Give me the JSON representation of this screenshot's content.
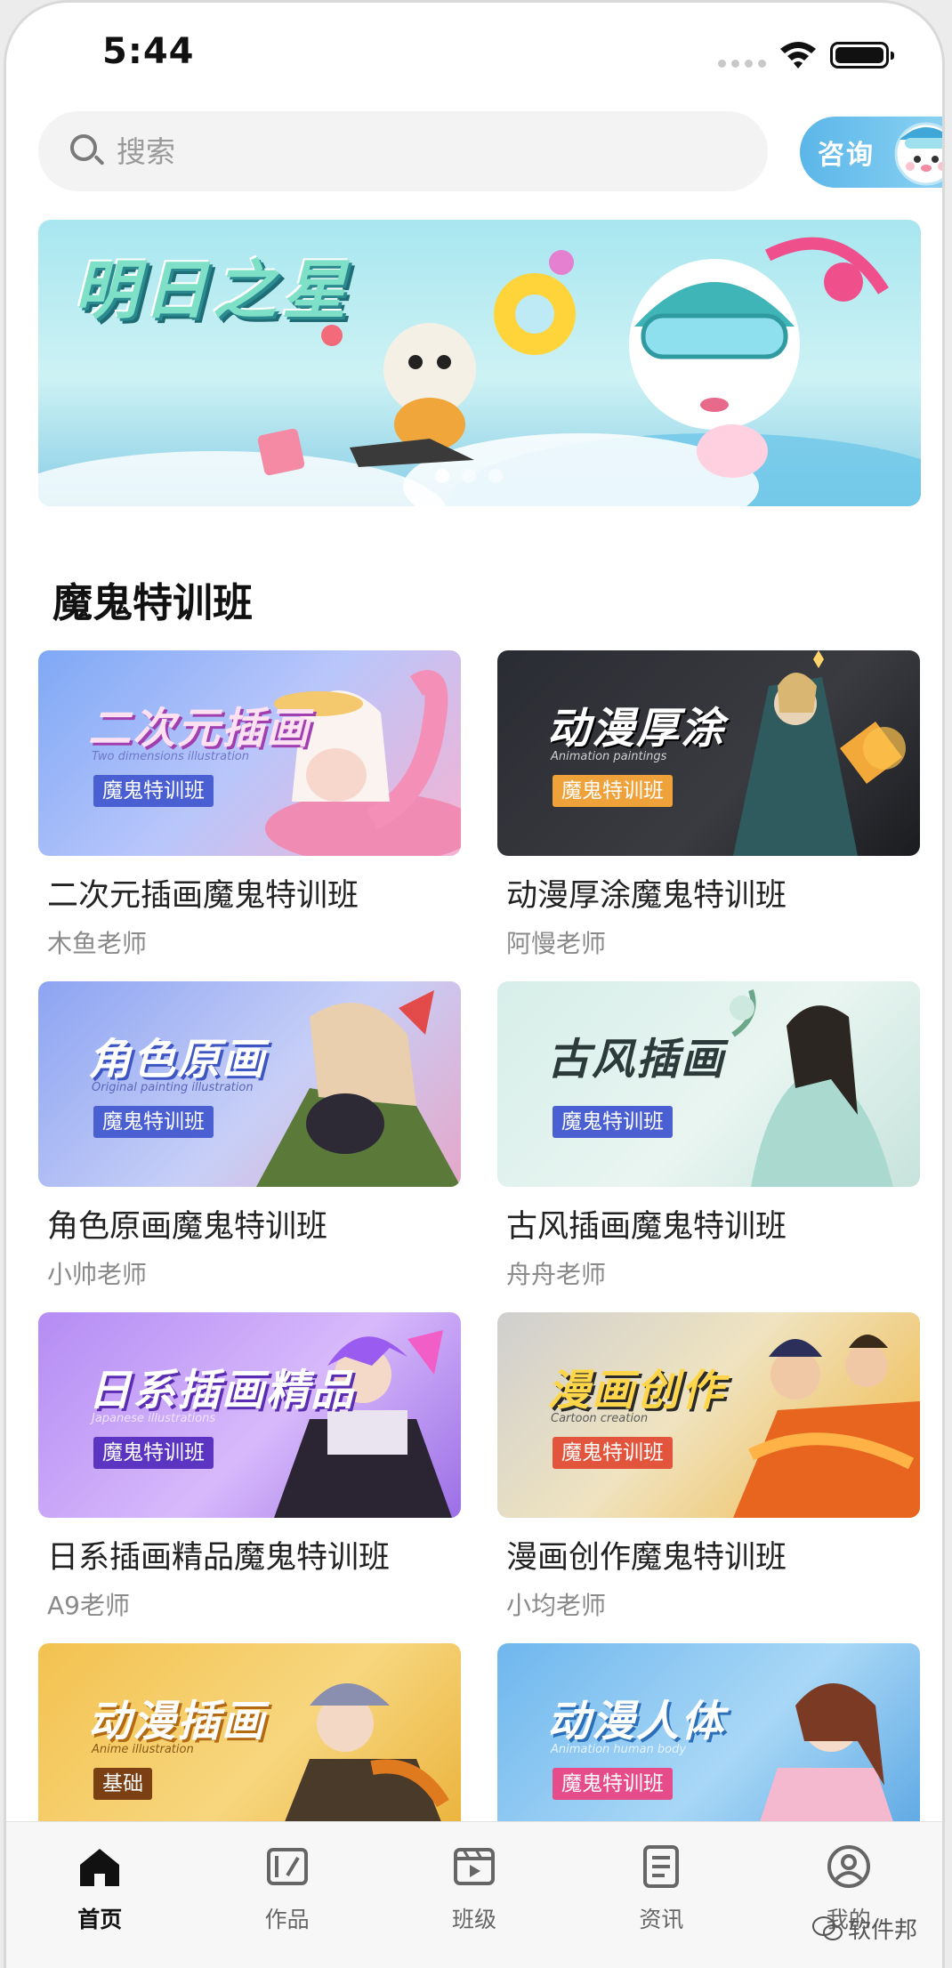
{
  "status_bar": {
    "time": "5:44"
  },
  "search": {
    "placeholder": "搜索"
  },
  "consult_button": {
    "label": "咨询"
  },
  "banner": {
    "title": "明日之星",
    "slide_count": 3,
    "active_slide": 1
  },
  "section": {
    "title": "魔鬼特训班"
  },
  "courses": [
    {
      "thumb_title": "二次元插画",
      "thumb_subtitle": "Two dimensions illustration",
      "badge": "魔鬼特训班",
      "title": "二次元插画魔鬼特训班",
      "teacher": "木鱼老师"
    },
    {
      "thumb_title": "动漫厚涂",
      "thumb_subtitle": "Animation paintings",
      "badge": "魔鬼特训班",
      "title": "动漫厚涂魔鬼特训班",
      "teacher": "阿慢老师"
    },
    {
      "thumb_title": "角色原画",
      "thumb_subtitle": "Original painting illustration",
      "badge": "魔鬼特训班",
      "title": "角色原画魔鬼特训班",
      "teacher": "小帅老师"
    },
    {
      "thumb_title": "古风插画",
      "thumb_subtitle": "",
      "badge": "魔鬼特训班",
      "title": "古风插画魔鬼特训班",
      "teacher": "舟舟老师"
    },
    {
      "thumb_title": "日系插画精品",
      "thumb_subtitle": "Japanese illustrations",
      "badge": "魔鬼特训班",
      "title": "日系插画精品魔鬼特训班",
      "teacher": "A9老师"
    },
    {
      "thumb_title": "漫画创作",
      "thumb_subtitle": "Cartoon creation",
      "badge": "魔鬼特训班",
      "title": "漫画创作魔鬼特训班",
      "teacher": "小均老师"
    },
    {
      "thumb_title": "动漫插画",
      "thumb_subtitle": "Anime illustration",
      "badge": "基础"
    },
    {
      "thumb_title": "动漫人体",
      "thumb_subtitle": "Animation human body",
      "badge": "魔鬼特训班"
    }
  ],
  "tabbar": {
    "items": [
      {
        "label": "首页",
        "icon": "home-icon",
        "active": true
      },
      {
        "label": "作品",
        "icon": "works-icon",
        "active": false
      },
      {
        "label": "班级",
        "icon": "class-icon",
        "active": false
      },
      {
        "label": "资讯",
        "icon": "news-icon",
        "active": false
      },
      {
        "label": "我的",
        "icon": "profile-icon",
        "active": false
      }
    ]
  },
  "watermark": {
    "text": "软件邦"
  },
  "colors": {
    "accent": "#5bb6e8",
    "badge_blue": "#4a5fd1",
    "badge_orange": "#f0a23a",
    "badge_red": "#e2553c",
    "badge_pink": "#e64b8a"
  }
}
